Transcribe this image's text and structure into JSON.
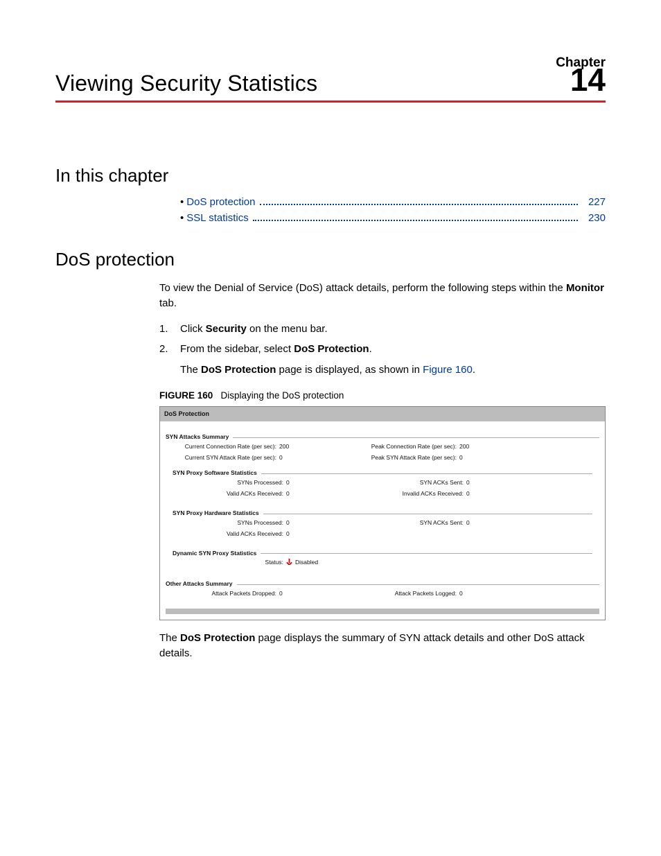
{
  "chapter": {
    "label": "Chapter",
    "number": "14",
    "title": "Viewing Security Statistics"
  },
  "toc": {
    "heading": "In this chapter",
    "items": [
      {
        "label": "DoS protection",
        "page": "227"
      },
      {
        "label": "SSL statistics",
        "page": "230"
      }
    ]
  },
  "section": {
    "heading": "DoS protection",
    "intro_pre": "To view the Denial of Service (DoS) attack details, perform the following steps within the ",
    "intro_bold": "Monitor",
    "intro_post": " tab.",
    "step1_num": "1.",
    "step1_pre": "Click ",
    "step1_bold": "Security",
    "step1_post": " on the menu bar.",
    "step2_num": "2.",
    "step2_pre": "From the sidebar, select ",
    "step2_bold": "DoS Protection",
    "step2_post": ".",
    "step2b_pre": "The ",
    "step2b_bold": "DoS Protection",
    "step2b_mid": " page is displayed, as shown in ",
    "step2b_link": "Figure 160",
    "step2b_post": ".",
    "figure_caption_bold": "FIGURE 160",
    "figure_caption_text": "Displaying the DoS protection",
    "closing_pre": "The ",
    "closing_bold": "DoS Protection",
    "closing_post": " page displays the summary of SYN attack details and other DoS attack details."
  },
  "figure": {
    "title": "DoS Protection",
    "syn_summary": {
      "legend": "SYN Attacks Summary",
      "rows": [
        {
          "l_k": "Current Connection Rate (per sec):",
          "l_v": "200",
          "r_k": "Peak Connection Rate (per sec):",
          "r_v": "200"
        },
        {
          "l_k": "Current SYN Attack Rate (per sec):",
          "l_v": "0",
          "r_k": "Peak SYN Attack Rate (per sec):",
          "r_v": "0"
        }
      ],
      "sw": {
        "legend": "SYN Proxy Software Statistics",
        "rows": [
          {
            "l_k": "SYNs Processed:",
            "l_v": "0",
            "r_k": "SYN ACKs Sent:",
            "r_v": "0"
          },
          {
            "l_k": "Valid ACKs Received:",
            "l_v": "0",
            "r_k": "Invalid ACKs Received:",
            "r_v": "0"
          }
        ]
      },
      "hw": {
        "legend": "SYN Proxy Hardware Statistics",
        "rows": [
          {
            "l_k": "SYNs Processed:",
            "l_v": "0",
            "r_k": "SYN ACKs Sent:",
            "r_v": "0"
          },
          {
            "l_k": "Valid ACKs Received:",
            "l_v": "0",
            "r_k": "",
            "r_v": ""
          }
        ]
      },
      "dyn": {
        "legend": "Dynamic SYN Proxy Statistics",
        "status_k": "Status:",
        "status_v": "Disabled"
      }
    },
    "other": {
      "legend": "Other Attacks Summary",
      "row": {
        "l_k": "Attack Packets Dropped:",
        "l_v": "0",
        "r_k": "Attack Packets Logged:",
        "r_v": "0"
      }
    }
  }
}
